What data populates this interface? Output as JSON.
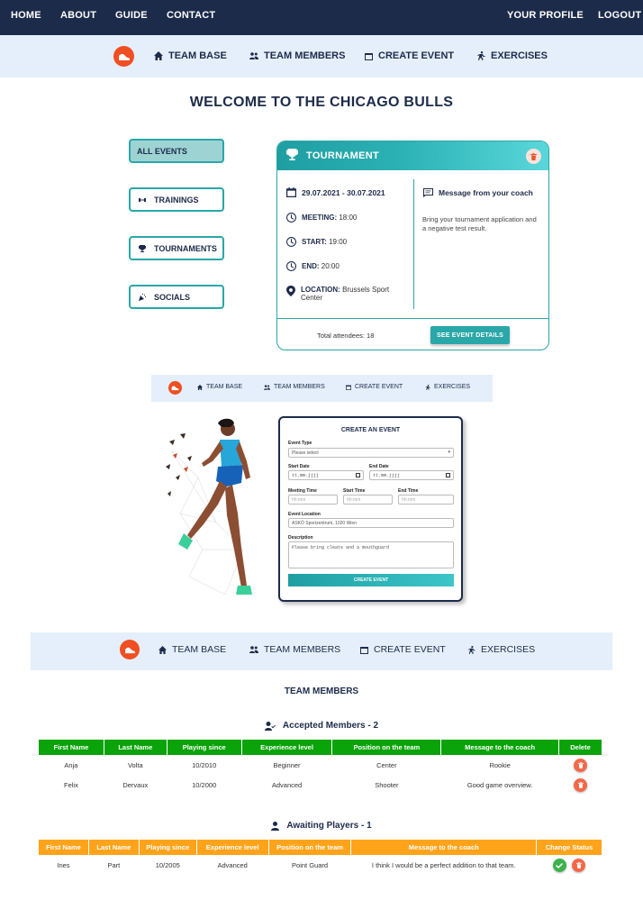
{
  "topnav": {
    "home": "HOME",
    "about": "ABOUT",
    "guide": "GUIDE",
    "contact": "CONTACT",
    "profile": "YOUR PROFILE",
    "logout": "LOGOUT"
  },
  "subnav": {
    "team_base": "TEAM BASE",
    "team_members": "TEAM MEMBERS",
    "create_event": "CREATE EVENT",
    "exercises": "EXERCISES"
  },
  "welcome": "WELCOME TO THE CHICAGO BULLS",
  "filters": {
    "all": "ALL EVENTS",
    "trainings": "TRAININGS",
    "tournaments": "TOURNAMENTS",
    "socials": "SOCIALS"
  },
  "event_card": {
    "type": "TOURNAMENT",
    "dates": "29.07.2021 - 30.07.2021",
    "meeting_label": "MEETING:",
    "meeting": "18:00",
    "start_label": "START:",
    "start": "19:00",
    "end_label": "END:",
    "end": "20:00",
    "location_label": "LOCATION:",
    "location": "Brussels Sport Center",
    "message_title": "Message from your coach",
    "message": "Bring your tournament application and a negative test result.",
    "attendees": "Total attendees: 18",
    "details_button": "SEE EVENT DETAILS"
  },
  "create_form": {
    "title": "CREATE AN EVENT",
    "event_type_label": "Event Type",
    "event_type_value": "Please select",
    "start_date_label": "Start Date",
    "start_date_value": "tt.mm.jjjj",
    "end_date_label": "End Date",
    "end_date_value": "tt.mm.jjjj",
    "meeting_time_label": "Meeting Time",
    "meeting_time_placeholder": "hh:mm",
    "start_time_label": "Start Time",
    "start_time_placeholder": "hh:mm",
    "end_time_label": "End Time",
    "end_time_placeholder": "hh:mm",
    "location_label": "Event Location",
    "location_value": "ASKÖ Sportzentrum, 1020 Wien",
    "description_label": "Description",
    "description_value": "Please bring cleats and a mouthguard",
    "submit": "CREATE EVENT"
  },
  "team_members": {
    "title": "TEAM MEMBERS",
    "accepted_title": "Accepted Members - 2",
    "accepted_headers": [
      "First Name",
      "Last Name",
      "Playing since",
      "Experience level",
      "Position on the team",
      "Message to the coach",
      "Delete"
    ],
    "accepted_rows": [
      [
        "Anja",
        "Volta",
        "10/2010",
        "Beginner",
        "Center",
        "Rookie"
      ],
      [
        "Felix",
        "Dervaux",
        "10/2000",
        "Advanced",
        "Shooter",
        "Good game overview."
      ]
    ],
    "awaiting_title": "Awaiting Players - 1",
    "awaiting_headers": [
      "First Name",
      "Last Name",
      "Playing since",
      "Experience level",
      "Position on the team",
      "Message to the coach",
      "Change Status"
    ],
    "awaiting_rows": [
      [
        "Ines",
        "Part",
        "10/2005",
        "Advanced",
        "Point Guard",
        "I think I would be a perfect addition to that team."
      ]
    ]
  },
  "colors": {
    "navy": "#1d2b4a",
    "teal": "#2aa7a8",
    "orange_logo": "#f04e23",
    "green_header": "#0aa30a",
    "orange_header": "#ffa31a",
    "delete_red": "#f4684a",
    "accept_green": "#3db24d",
    "subnav_bg": "#e4effb"
  },
  "icons": [
    "logo-shoe-icon",
    "home-icon",
    "people-icon",
    "calendar-icon",
    "runner-icon",
    "trophy-icon",
    "trash-icon",
    "dumbbell-icon",
    "party-icon",
    "clock-icon",
    "location-pin-icon",
    "message-icon",
    "user-check-icon",
    "user-icon",
    "check-icon"
  ]
}
